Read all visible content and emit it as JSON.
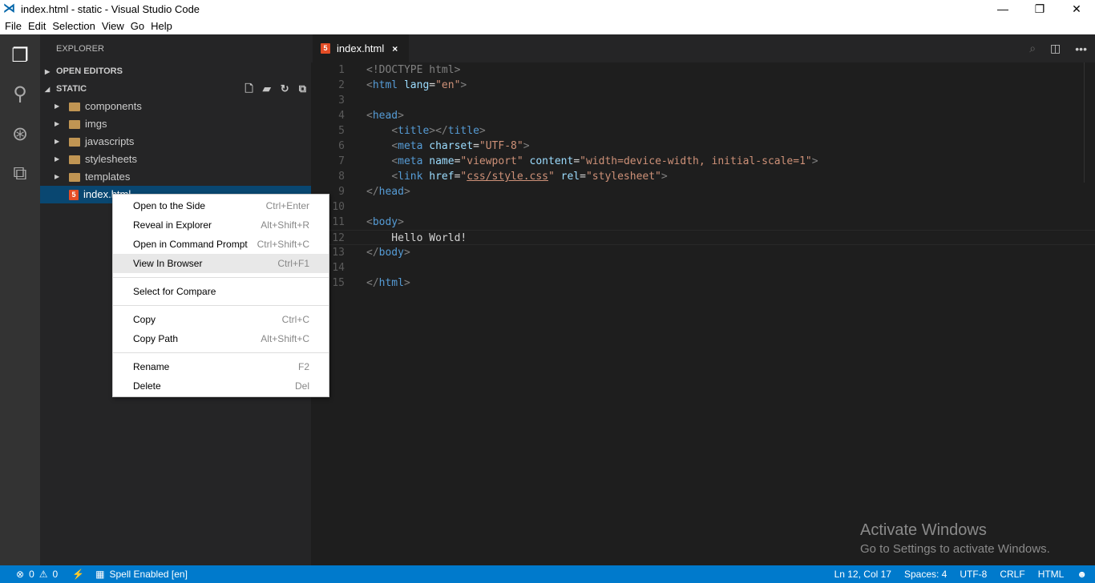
{
  "window": {
    "title": "index.html - static - Visual Studio Code",
    "minimize": "—",
    "maximize": "❐",
    "close": "✕"
  },
  "menubar": [
    "File",
    "Edit",
    "Selection",
    "View",
    "Go",
    "Help"
  ],
  "sidebar": {
    "title": "EXPLORER",
    "open_editors": "OPEN EDITORS",
    "folder": "STATIC",
    "items": [
      {
        "label": "components",
        "type": "folder"
      },
      {
        "label": "imgs",
        "type": "folder"
      },
      {
        "label": "javascripts",
        "type": "folder"
      },
      {
        "label": "stylesheets",
        "type": "folder"
      },
      {
        "label": "templates",
        "type": "folder"
      },
      {
        "label": "index.html",
        "type": "html",
        "selected": true
      }
    ]
  },
  "tab": {
    "label": "index.html",
    "close": "×"
  },
  "editor": {
    "current_line": 12,
    "lines": [
      [
        [
          "punct",
          "<"
        ],
        [
          "punct",
          "!DOCTYPE html"
        ],
        [
          "punct",
          ">"
        ]
      ],
      [
        [
          "punct",
          "<"
        ],
        [
          "tag",
          "html"
        ],
        [
          "text",
          " "
        ],
        [
          "attr",
          "lang"
        ],
        [
          "text",
          "="
        ],
        [
          "str",
          "\"en\""
        ],
        [
          "punct",
          ">"
        ]
      ],
      [],
      [
        [
          "punct",
          "<"
        ],
        [
          "tag",
          "head"
        ],
        [
          "punct",
          ">"
        ]
      ],
      [
        [
          "text",
          "    "
        ],
        [
          "punct",
          "<"
        ],
        [
          "tag",
          "title"
        ],
        [
          "punct",
          "></"
        ],
        [
          "tag",
          "title"
        ],
        [
          "punct",
          ">"
        ]
      ],
      [
        [
          "text",
          "    "
        ],
        [
          "punct",
          "<"
        ],
        [
          "tag",
          "meta"
        ],
        [
          "text",
          " "
        ],
        [
          "attr",
          "charset"
        ],
        [
          "text",
          "="
        ],
        [
          "str",
          "\"UTF-8\""
        ],
        [
          "punct",
          ">"
        ]
      ],
      [
        [
          "text",
          "    "
        ],
        [
          "punct",
          "<"
        ],
        [
          "tag",
          "meta"
        ],
        [
          "text",
          " "
        ],
        [
          "attr",
          "name"
        ],
        [
          "text",
          "="
        ],
        [
          "str",
          "\"viewport\""
        ],
        [
          "text",
          " "
        ],
        [
          "attr",
          "content"
        ],
        [
          "text",
          "="
        ],
        [
          "str",
          "\"width=device-width, initial-scale=1\""
        ],
        [
          "punct",
          ">"
        ]
      ],
      [
        [
          "text",
          "    "
        ],
        [
          "punct",
          "<"
        ],
        [
          "tag",
          "link"
        ],
        [
          "text",
          " "
        ],
        [
          "attr",
          "href"
        ],
        [
          "text",
          "="
        ],
        [
          "str",
          "\""
        ],
        [
          "link",
          "css/style.css"
        ],
        [
          "str",
          "\""
        ],
        [
          "text",
          " "
        ],
        [
          "attr",
          "rel"
        ],
        [
          "text",
          "="
        ],
        [
          "str",
          "\"stylesheet\""
        ],
        [
          "punct",
          ">"
        ]
      ],
      [
        [
          "punct",
          "</"
        ],
        [
          "tag",
          "head"
        ],
        [
          "punct",
          ">"
        ]
      ],
      [],
      [
        [
          "punct",
          "<"
        ],
        [
          "tag",
          "body"
        ],
        [
          "punct",
          ">"
        ]
      ],
      [
        [
          "text",
          "    Hello World!"
        ]
      ],
      [
        [
          "punct",
          "</"
        ],
        [
          "tag",
          "body"
        ],
        [
          "punct",
          ">"
        ]
      ],
      [],
      [
        [
          "punct",
          "</"
        ],
        [
          "tag",
          "html"
        ],
        [
          "punct",
          ">"
        ]
      ]
    ]
  },
  "context_menu": [
    [
      {
        "label": "Open to the Side",
        "key": "Ctrl+Enter"
      },
      {
        "label": "Reveal in Explorer",
        "key": "Alt+Shift+R"
      },
      {
        "label": "Open in Command Prompt",
        "key": "Ctrl+Shift+C"
      },
      {
        "label": "View In Browser",
        "key": "Ctrl+F1",
        "highlighted": true
      }
    ],
    [
      {
        "label": "Select for Compare",
        "key": ""
      }
    ],
    [
      {
        "label": "Copy",
        "key": "Ctrl+C"
      },
      {
        "label": "Copy Path",
        "key": "Alt+Shift+C"
      }
    ],
    [
      {
        "label": "Rename",
        "key": "F2"
      },
      {
        "label": "Delete",
        "key": "Del"
      }
    ]
  ],
  "watermark": {
    "title": "Activate Windows",
    "subtitle": "Go to Settings to activate Windows."
  },
  "status": {
    "errors": "0",
    "warnings": "0",
    "spell": "Spell Enabled [en]",
    "position": "Ln 12, Col 17",
    "spaces": "Spaces: 4",
    "encoding": "UTF-8",
    "eol": "CRLF",
    "language": "HTML"
  }
}
